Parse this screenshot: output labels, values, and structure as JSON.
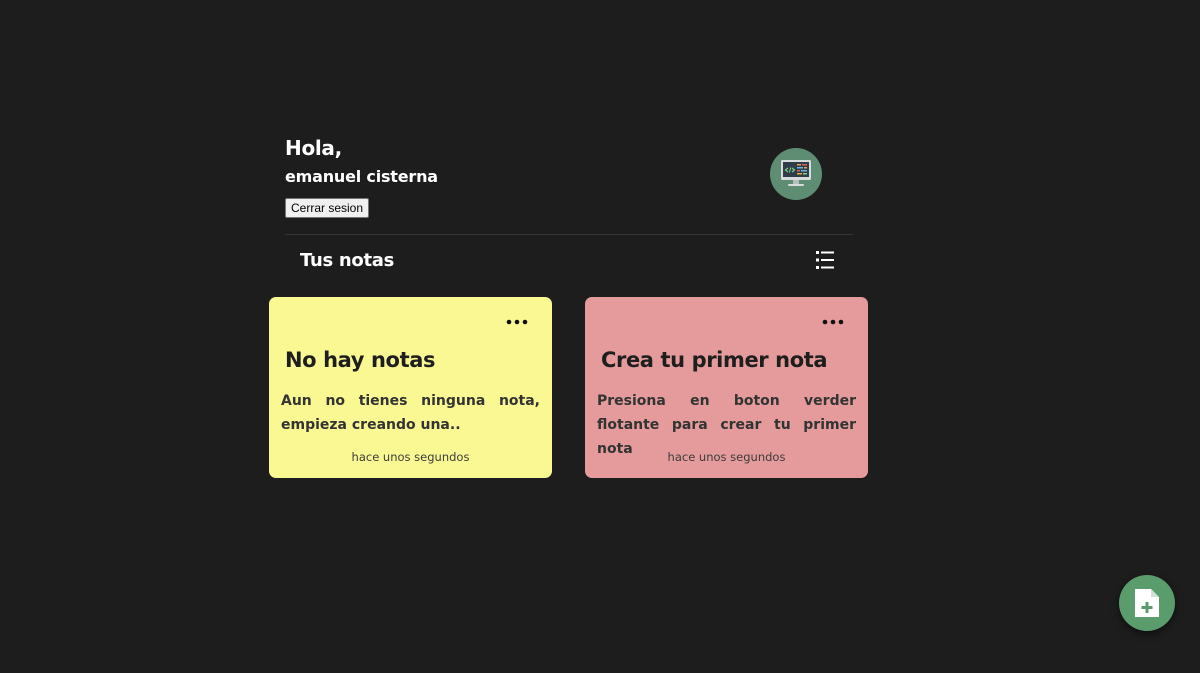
{
  "header": {
    "greeting": "Hola,",
    "username": "emanuel cisterna",
    "logout_label": "Cerrar sesion",
    "avatar_icon": "computer-monitor-icon"
  },
  "notes_section": {
    "title": "Tus notas",
    "view_toggle_icon": "list-view-icon"
  },
  "notes": [
    {
      "title": "No hay notas",
      "body": "Aun no tienes ninguna nota, empieza creando una..",
      "time": "hace unos segundos",
      "color": "#f9f893",
      "menu_icon": "more-horizontal-icon"
    },
    {
      "title": "Crea tu primer nota",
      "body": "Presiona en boton verder flotante para crear tu primer nota",
      "time": "hace unos segundos",
      "color": "#e59b9b",
      "menu_icon": "more-horizontal-icon"
    }
  ],
  "fab": {
    "icon": "add-note-icon",
    "color": "#5b9c6c"
  },
  "colors": {
    "background": "#1d1d1d",
    "text": "#ffffff"
  }
}
